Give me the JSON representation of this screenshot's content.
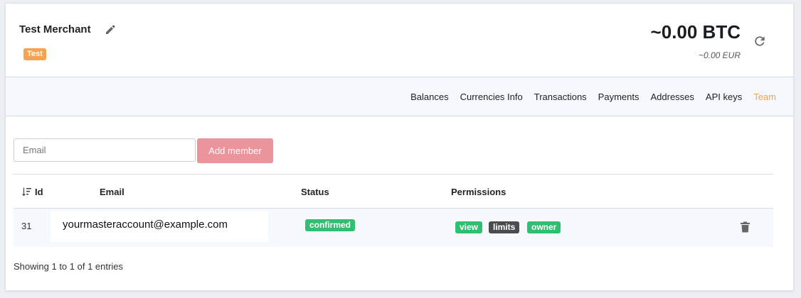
{
  "header": {
    "merchant_name": "Test Merchant",
    "environment_badge": "Test",
    "btc_balance": "~0.00 BTC",
    "eur_balance": "~0.00 EUR",
    "icons": {
      "edit": "pencil-icon",
      "refresh": "refresh-icon"
    }
  },
  "nav": {
    "items": [
      {
        "label": "Balances"
      },
      {
        "label": "Currencies Info"
      },
      {
        "label": "Transactions"
      },
      {
        "label": "Payments"
      },
      {
        "label": "Addresses"
      },
      {
        "label": "API keys"
      },
      {
        "label": "Team"
      }
    ],
    "active": "Team",
    "active_color": "#f5a04f"
  },
  "team": {
    "email_placeholder": "Email",
    "email_value": "",
    "add_button_label": "Add member",
    "add_button_color": "#ec949b",
    "table": {
      "columns": {
        "id": "Id",
        "email": "Email",
        "status": "Status",
        "permissions": "Permissions"
      },
      "rows": [
        {
          "id": "31",
          "email": "yourmasteraccount@example.com",
          "status": "confirmed",
          "permissions": [
            "view",
            "limits",
            "owner"
          ]
        }
      ]
    },
    "footer": "Showing 1 to 1 of 1 entries"
  },
  "colors": {
    "badge_green": "#2fbf71",
    "badge_dark": "#4a4c4f",
    "env_badge": "#f7a253"
  }
}
